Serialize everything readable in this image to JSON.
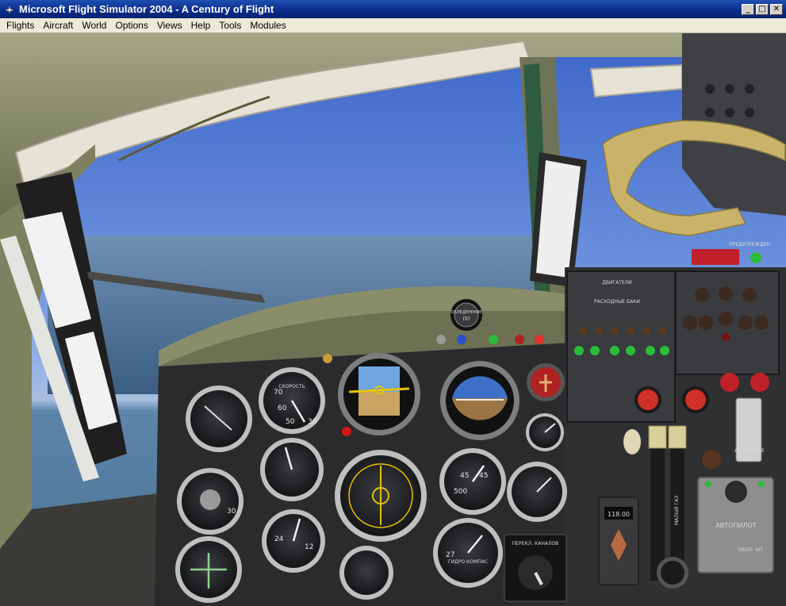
{
  "window": {
    "title": "Microsoft Flight Simulator 2004 - A Century of Flight",
    "minimize_glyph": "_",
    "maximize_glyph": "□",
    "close_glyph": "✕"
  },
  "menu": [
    {
      "label": "Flights"
    },
    {
      "label": "Aircraft"
    },
    {
      "label": "World"
    },
    {
      "label": "Options"
    },
    {
      "label": "Views"
    },
    {
      "label": "Help"
    },
    {
      "label": "Tools"
    },
    {
      "label": "Modules"
    }
  ],
  "cockpit": {
    "warning_light_top": "ОБЛЕДЕНЕНИЕ",
    "warning_light_bottom": "ПП",
    "autopilot_label": "АВТОПИЛОТ",
    "channel_label": "ПЕРЕКЛ. КАНАЛОВ",
    "warning_label": "ПРЕДУПРЕЖДЕН.",
    "fuel_panel_title": "РАСХОДНЫЕ БАКИ",
    "engine_label": "ДВИГАТЕЛИ",
    "mass_gaz_label": "МАЛЫЙ ГАЗ",
    "emergency_label": "АВАРИЙНОЕ",
    "asi_label": "СКОРОСТЬ",
    "compass_label": "ГИДРО КОМПАС",
    "nav_freq": "118.00",
    "ap_label_bottom": "ОБОЛ. АП"
  },
  "colors": {
    "titlebar": "#0a2a8a",
    "menubar": "#ece9d8",
    "panel": "#2a2b2d",
    "cockpit_frame": "#8b8f6a",
    "warning_red": "#c0202a"
  }
}
